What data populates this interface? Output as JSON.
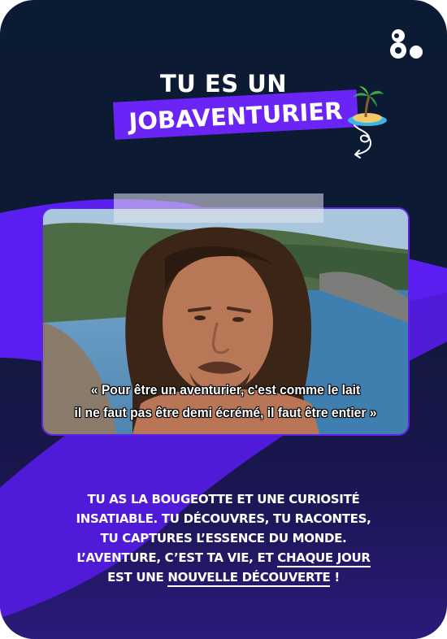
{
  "title": {
    "line1": "TU ES UN",
    "line2": "JOBAVENTURIER"
  },
  "icons": {
    "logo": "8.-logo-icon",
    "island": "desert-island-emoji-icon",
    "arrow": "curly-arrow-icon"
  },
  "photo": {
    "subtitle_line1": "« Pour être un aventurier, c'est comme le lait",
    "subtitle_line2": "il ne faut pas être demi écrémé, il faut être entier »"
  },
  "description": {
    "line1": "TU AS LA BOUGEOTTE ET UNE CURIOSITÉ",
    "line2": "INSATIABLE. TU DÉCOUVRES, TU RACONTES,",
    "line3": "TU CAPTURES L’ESSENCE DU MONDE.",
    "line4_pre": "L’AVENTURE, C’EST TA VIE, ET ",
    "line4_u": "CHAQUE JOUR",
    "line5_pre": "EST UNE ",
    "line5_u": "NOUVELLE DÉCOUVERTE",
    "line5_post": " !"
  },
  "colors": {
    "background": "#0b1b33",
    "accent_purple": "#6a24f5",
    "text": "#ffffff"
  }
}
